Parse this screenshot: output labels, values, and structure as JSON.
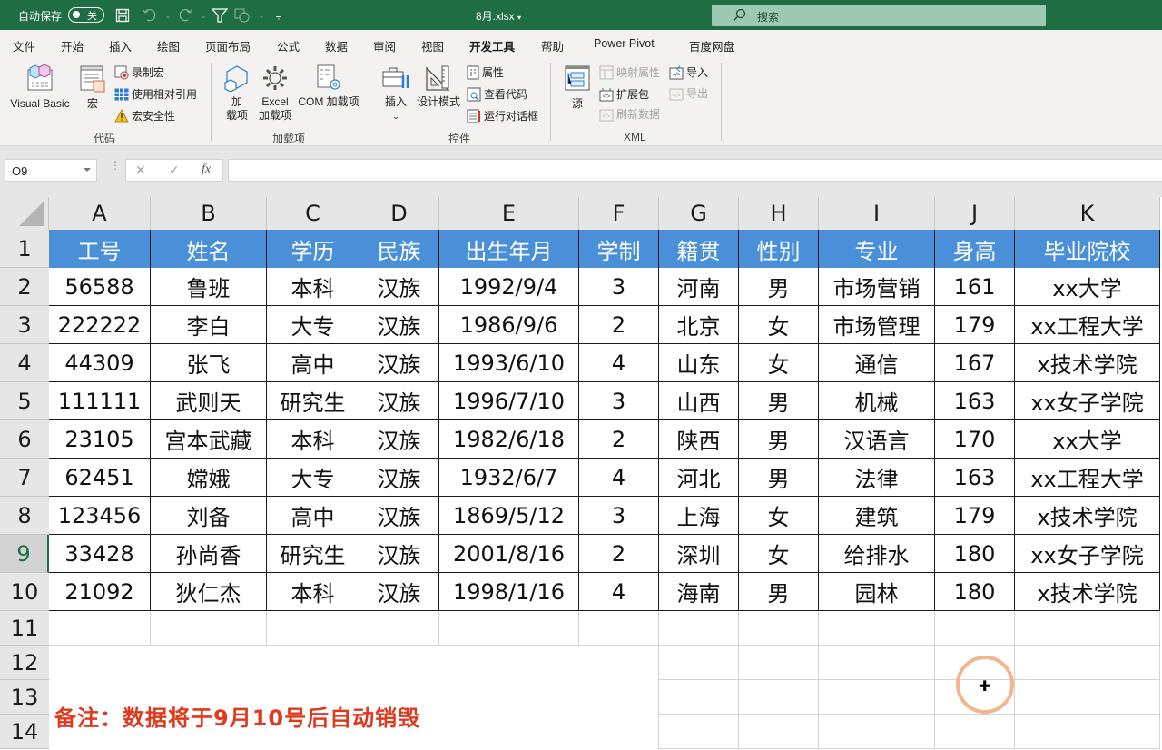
{
  "titlebar": {
    "autosave_label": "自动保存",
    "autosave_state": "关",
    "filename": "8月.xlsx",
    "search_placeholder": "搜索"
  },
  "ribbon_tabs": [
    {
      "label": "文件",
      "active": false
    },
    {
      "label": "开始",
      "active": false
    },
    {
      "label": "插入",
      "active": false
    },
    {
      "label": "绘图",
      "active": false
    },
    {
      "label": "页面布局",
      "active": false
    },
    {
      "label": "公式",
      "active": false
    },
    {
      "label": "数据",
      "active": false
    },
    {
      "label": "审阅",
      "active": false
    },
    {
      "label": "视图",
      "active": false
    },
    {
      "label": "开发工具",
      "active": true
    },
    {
      "label": "帮助",
      "active": false
    },
    {
      "label": "Power Pivot",
      "active": false
    },
    {
      "label": "百度网盘",
      "active": false
    }
  ],
  "ribbon": {
    "code": {
      "group_label": "代码",
      "visual_basic": "Visual Basic",
      "macros": "宏",
      "record_macro": "录制宏",
      "relative_ref": "使用相对引用",
      "macro_security": "宏安全性"
    },
    "addins": {
      "group_label": "加载项",
      "addins_line1": "加",
      "addins_line2": "载项",
      "excel_addins_line1": "Excel",
      "excel_addins_line2": "加载项",
      "com_addins": "COM 加载项"
    },
    "controls": {
      "group_label": "控件",
      "insert": "插入",
      "design_mode": "设计模式",
      "properties": "属性",
      "view_code": "查看代码",
      "run_dialog": "运行对话框"
    },
    "xml": {
      "group_label": "XML",
      "source": "源",
      "map_properties": "映射属性",
      "expansion_packs": "扩展包",
      "refresh_data": "刷新数据",
      "import": "导入",
      "export": "导出"
    }
  },
  "formula_bar": {
    "name_box": "O9",
    "cancel": "✕",
    "enter": "✓",
    "fx": "fx",
    "formula": ""
  },
  "sheet": {
    "columns": [
      "A",
      "B",
      "C",
      "D",
      "E",
      "F",
      "G",
      "H",
      "I",
      "J",
      "K"
    ],
    "rows": [
      "1",
      "2",
      "3",
      "4",
      "5",
      "6",
      "7",
      "8",
      "9",
      "10",
      "11",
      "12",
      "13",
      "14"
    ],
    "selected_row": "9",
    "headers": [
      "工号",
      "姓名",
      "学历",
      "民族",
      "出生年月",
      "学制",
      "籍贯",
      "性别",
      "专业",
      "身高",
      "毕业院校"
    ],
    "data": [
      [
        "56588",
        "鲁班",
        "本科",
        "汉族",
        "1992/9/4",
        "3",
        "河南",
        "男",
        "市场营销",
        "161",
        "xx大学"
      ],
      [
        "222222",
        "李白",
        "大专",
        "汉族",
        "1986/9/6",
        "2",
        "北京",
        "女",
        "市场管理",
        "179",
        "xx工程大学"
      ],
      [
        "44309",
        "张飞",
        "高中",
        "汉族",
        "1993/6/10",
        "4",
        "山东",
        "女",
        "通信",
        "167",
        "x技术学院"
      ],
      [
        "111111",
        "武则天",
        "研究生",
        "汉族",
        "1996/7/10",
        "3",
        "山西",
        "男",
        "机械",
        "163",
        "xx女子学院"
      ],
      [
        "23105",
        "宫本武藏",
        "本科",
        "汉族",
        "1982/6/18",
        "2",
        "陕西",
        "男",
        "汉语言",
        "170",
        "xx大学"
      ],
      [
        "62451",
        "嫦娥",
        "大专",
        "汉族",
        "1932/6/7",
        "4",
        "河北",
        "男",
        "法律",
        "163",
        "xx工程大学"
      ],
      [
        "123456",
        "刘备",
        "高中",
        "汉族",
        "1869/5/12",
        "3",
        "上海",
        "女",
        "建筑",
        "179",
        "x技术学院"
      ],
      [
        "33428",
        "孙尚香",
        "研究生",
        "汉族",
        "2001/8/16",
        "2",
        "深圳",
        "女",
        "给排水",
        "180",
        "xx女子学院"
      ],
      [
        "21092",
        "狄仁杰",
        "本科",
        "汉族",
        "1998/1/16",
        "4",
        "海南",
        "男",
        "园林",
        "180",
        "x技术学院"
      ]
    ],
    "note": "备注：数据将于9月10号后自动销毁"
  },
  "colors": {
    "title_green": "#1f6e43",
    "header_blue": "#4a90d9",
    "note_red": "#e03a1e"
  }
}
